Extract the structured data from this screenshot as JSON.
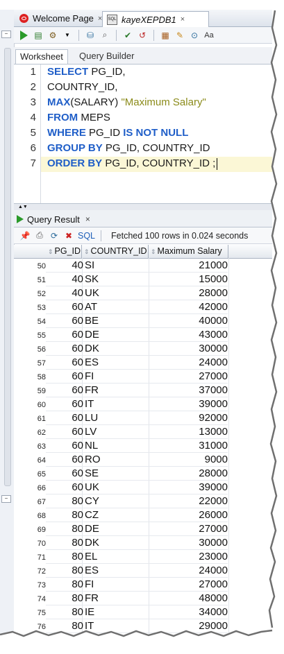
{
  "tabs": [
    {
      "label": "Welcome Page",
      "icon": "oracle-icon"
    },
    {
      "label": "kayeXEPDB1",
      "icon": "sql-icon"
    }
  ],
  "subtabs": [
    "Worksheet",
    "Query Builder"
  ],
  "editor": {
    "lines": [
      {
        "n": "1",
        "parts": [
          {
            "t": "SELECT",
            "k": "kw"
          },
          {
            "t": " PG_ID,",
            "k": ""
          }
        ]
      },
      {
        "n": "2",
        "parts": [
          {
            "t": "COUNTRY_ID,",
            "k": ""
          }
        ]
      },
      {
        "n": "3",
        "parts": [
          {
            "t": "MAX",
            "k": "kw"
          },
          {
            "t": "(SALARY) ",
            "k": ""
          },
          {
            "t": "\"Maximum Salary\"",
            "k": "str"
          }
        ]
      },
      {
        "n": "4",
        "parts": [
          {
            "t": "FROM",
            "k": "kw"
          },
          {
            "t": " MEPS",
            "k": ""
          }
        ]
      },
      {
        "n": "5",
        "parts": [
          {
            "t": "WHERE",
            "k": "kw"
          },
          {
            "t": " PG_ID ",
            "k": ""
          },
          {
            "t": "IS NOT NULL",
            "k": "kw"
          }
        ]
      },
      {
        "n": "6",
        "parts": [
          {
            "t": "GROUP BY",
            "k": "kw"
          },
          {
            "t": " PG_ID, COUNTRY_ID",
            "k": ""
          }
        ]
      },
      {
        "n": "7",
        "parts": [
          {
            "t": "ORDER BY",
            "k": "kw"
          },
          {
            "t": " PG_ID, COUNTRY_ID ;",
            "k": ""
          }
        ]
      }
    ]
  },
  "result": {
    "tab_label": "Query Result",
    "close": "×",
    "sql_label": "SQL",
    "fetched": "Fetched 100 rows in 0.024 seconds",
    "columns": [
      "PG_ID",
      "COUNTRY_ID",
      "Maximum Salary"
    ],
    "rows": [
      [
        "50",
        "40",
        "SI",
        "21000"
      ],
      [
        "51",
        "40",
        "SK",
        "15000"
      ],
      [
        "52",
        "40",
        "UK",
        "28000"
      ],
      [
        "53",
        "60",
        "AT",
        "42000"
      ],
      [
        "54",
        "60",
        "BE",
        "40000"
      ],
      [
        "55",
        "60",
        "DE",
        "43000"
      ],
      [
        "56",
        "60",
        "DK",
        "30000"
      ],
      [
        "57",
        "60",
        "ES",
        "24000"
      ],
      [
        "58",
        "60",
        "FI",
        "27000"
      ],
      [
        "59",
        "60",
        "FR",
        "37000"
      ],
      [
        "60",
        "60",
        "IT",
        "39000"
      ],
      [
        "61",
        "60",
        "LU",
        "92000"
      ],
      [
        "62",
        "60",
        "LV",
        "13000"
      ],
      [
        "63",
        "60",
        "NL",
        "31000"
      ],
      [
        "64",
        "60",
        "RO",
        "9000"
      ],
      [
        "65",
        "60",
        "SE",
        "28000"
      ],
      [
        "66",
        "60",
        "UK",
        "39000"
      ],
      [
        "67",
        "80",
        "CY",
        "22000"
      ],
      [
        "68",
        "80",
        "CZ",
        "26000"
      ],
      [
        "69",
        "80",
        "DE",
        "27000"
      ],
      [
        "70",
        "80",
        "DK",
        "30000"
      ],
      [
        "71",
        "80",
        "EL",
        "23000"
      ],
      [
        "72",
        "80",
        "ES",
        "24000"
      ],
      [
        "73",
        "80",
        "FI",
        "27000"
      ],
      [
        "74",
        "80",
        "FR",
        "48000"
      ],
      [
        "75",
        "80",
        "IE",
        "34000"
      ],
      [
        "76",
        "80",
        "IT",
        "29000"
      ]
    ]
  },
  "colors": {
    "keyword": "#1f5ec8",
    "string": "#8b8b1a",
    "current_line": "#fbf7d6",
    "run": "#2a9a2a"
  }
}
